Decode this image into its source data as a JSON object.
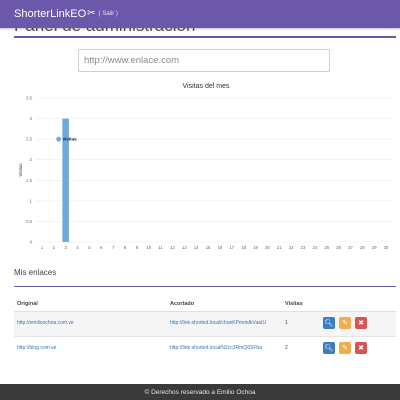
{
  "header": {
    "brand": "ShorterLinkEO",
    "logout": "( Salir )",
    "page_title": "Panel de administración"
  },
  "url_input": {
    "placeholder": "http://www.enlace.com",
    "value": ""
  },
  "chart_data": {
    "type": "bar",
    "title": "Visitas del mes",
    "ylabel": "Visitas",
    "xlabel": "",
    "ylim": [
      0,
      3.5
    ],
    "yticks": [
      "0",
      "0.5",
      "1",
      "1.5",
      "2",
      "2.5",
      "3",
      "3.5"
    ],
    "categories": [
      "1",
      "2",
      "3",
      "4",
      "5",
      "6",
      "7",
      "8",
      "9",
      "10",
      "11",
      "12",
      "13",
      "14",
      "15",
      "16",
      "17",
      "18",
      "19",
      "20",
      "21",
      "22",
      "23",
      "24",
      "25",
      "26",
      "27",
      "28",
      "29",
      "30"
    ],
    "series": [
      {
        "name": "visitas",
        "values": [
          0,
          0,
          3,
          0,
          0,
          0,
          0,
          0,
          0,
          0,
          0,
          0,
          0,
          0,
          0,
          0,
          0,
          0,
          0,
          0,
          0,
          0,
          0,
          0,
          0,
          0,
          0,
          0,
          0,
          0
        ]
      }
    ],
    "legend_position": "top-left",
    "grid": true,
    "bar_color": "#6fa8dc"
  },
  "links": {
    "section_title": "Mis enlaces",
    "headers": [
      "Original",
      "Acortado",
      "Visitas"
    ],
    "rows": [
      {
        "original": "http://emilioochoa.com.ve",
        "short": "http://link-shorted.local/chueKPmmdkVaaIU",
        "visits": "1"
      },
      {
        "original": "http://blog.com.ve",
        "short": "http://link-shorted.local/N2cc3RmQ6SFba",
        "visits": "2"
      }
    ],
    "actions": {
      "view_icon": "search-icon",
      "edit_icon": "pencil-icon",
      "delete_icon": "close-icon"
    }
  },
  "colors": {
    "accent": "#6c58aa",
    "view": "#3d7bc3",
    "edit": "#f0ad4e",
    "delete": "#d9534f",
    "footer_bg": "#3a3a3a"
  },
  "footer": {
    "text": "© Derechos reservado a Emilio Ochoa"
  }
}
